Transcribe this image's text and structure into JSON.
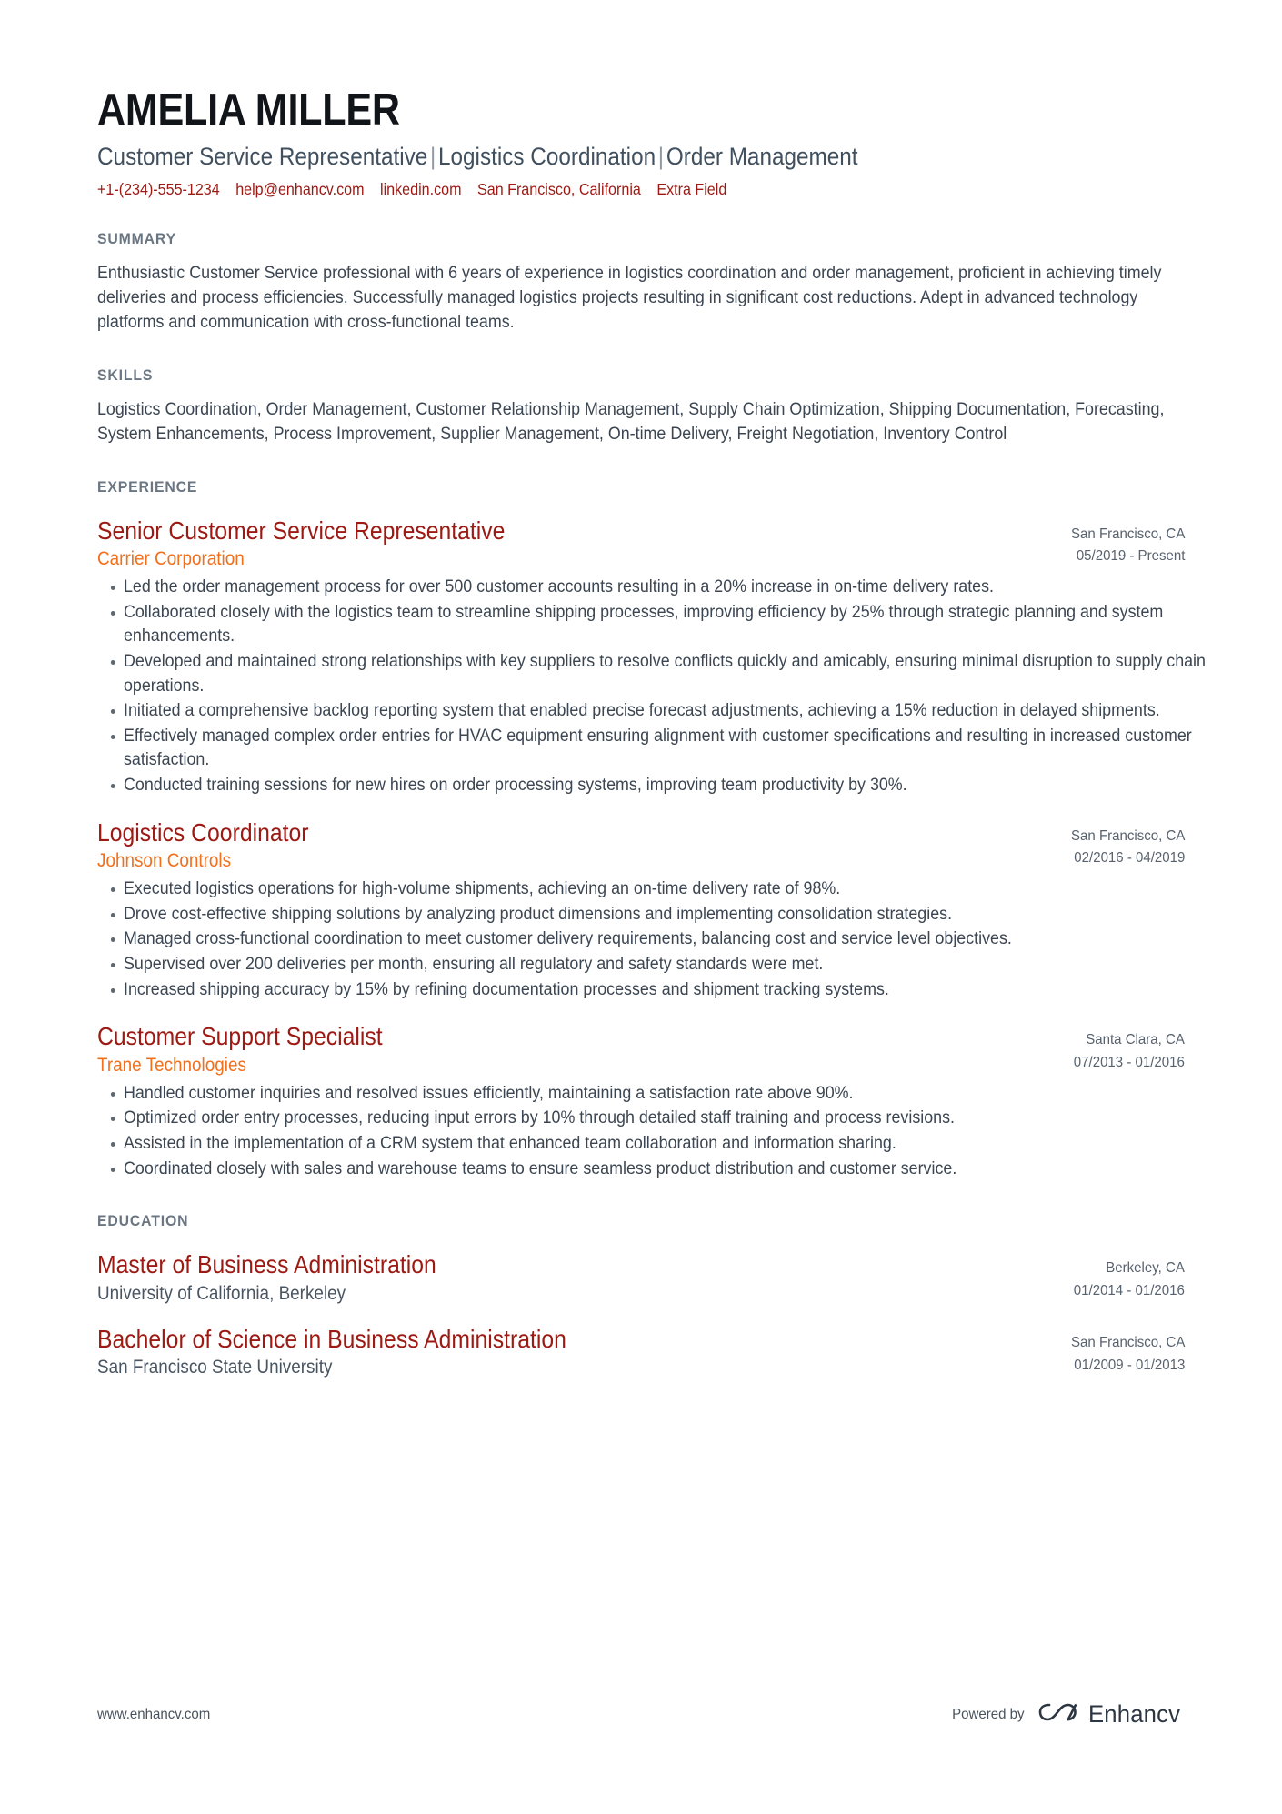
{
  "header": {
    "name": "AMELIA MILLER",
    "headline_parts": [
      "Customer Service Representative",
      "Logistics Coordination",
      "Order Management"
    ],
    "headline_separator": "|",
    "contact": [
      {
        "name": "phone",
        "value": "+1-(234)-555-1234"
      },
      {
        "name": "email",
        "value": "help@enhancv.com"
      },
      {
        "name": "linkedin",
        "value": "linkedin.com"
      },
      {
        "name": "location",
        "value": "San Francisco, California"
      },
      {
        "name": "extra",
        "value": "Extra Field"
      }
    ]
  },
  "summary": {
    "title": "SUMMARY",
    "text": "Enthusiastic Customer Service professional with 6 years of experience in logistics coordination and order management, proficient in achieving timely deliveries and process efficiencies. Successfully managed logistics projects resulting in significant cost reductions. Adept in advanced technology platforms and communication with cross-functional teams."
  },
  "skills": {
    "title": "SKILLS",
    "text": "Logistics Coordination, Order Management, Customer Relationship Management, Supply Chain Optimization, Shipping Documentation, Forecasting, System Enhancements, Process Improvement, Supplier Management, On-time Delivery, Freight Negotiation, Inventory Control"
  },
  "experience": {
    "title": "EXPERIENCE",
    "entries": [
      {
        "job_title": "Senior Customer Service Representative",
        "company": "Carrier Corporation",
        "location": "San Francisco, CA",
        "dates": "05/2019 - Present",
        "bullets": [
          "Led the order management process for over 500 customer accounts resulting in a 20% increase in on-time delivery rates.",
          "Collaborated closely with the logistics team to streamline shipping processes, improving efficiency by 25% through strategic planning and system enhancements.",
          "Developed and maintained strong relationships with key suppliers to resolve conflicts quickly and amicably, ensuring minimal disruption to supply chain operations.",
          "Initiated a comprehensive backlog reporting system that enabled precise forecast adjustments, achieving a 15% reduction in delayed shipments.",
          "Effectively managed complex order entries for HVAC equipment ensuring alignment with customer specifications and resulting in increased customer satisfaction.",
          "Conducted training sessions for new hires on order processing systems, improving team productivity by 30%."
        ]
      },
      {
        "job_title": "Logistics Coordinator",
        "company": "Johnson Controls",
        "location": "San Francisco, CA",
        "dates": "02/2016 - 04/2019",
        "bullets": [
          "Executed logistics operations for high-volume shipments, achieving an on-time delivery rate of 98%.",
          "Drove cost-effective shipping solutions by analyzing product dimensions and implementing consolidation strategies.",
          "Managed cross-functional coordination to meet customer delivery requirements, balancing cost and service level objectives.",
          "Supervised over 200 deliveries per month, ensuring all regulatory and safety standards were met.",
          "Increased shipping accuracy by 15% by refining documentation processes and shipment tracking systems."
        ]
      },
      {
        "job_title": "Customer Support Specialist",
        "company": "Trane Technologies",
        "location": "Santa Clara, CA",
        "dates": "07/2013 - 01/2016",
        "bullets": [
          "Handled customer inquiries and resolved issues efficiently, maintaining a satisfaction rate above 90%.",
          "Optimized order entry processes, reducing input errors by 10% through detailed staff training and process revisions.",
          "Assisted in the implementation of a CRM system that enhanced team collaboration and information sharing.",
          "Coordinated closely with sales and warehouse teams to ensure seamless product distribution and customer service."
        ]
      }
    ]
  },
  "education": {
    "title": "EDUCATION",
    "entries": [
      {
        "degree": "Master of Business Administration",
        "school": "University of California, Berkeley",
        "location": "Berkeley, CA",
        "dates": "01/2014 - 01/2016"
      },
      {
        "degree": "Bachelor of Science in Business Administration",
        "school": "San Francisco State University",
        "location": "San Francisco, CA",
        "dates": "01/2009 - 01/2013"
      }
    ]
  },
  "footer": {
    "url": "www.enhancv.com",
    "powered_by": "Powered by",
    "brand": "Enhancv"
  },
  "colors": {
    "accent_red": "#9c1a13",
    "accent_orange": "#f2701d",
    "section_title": "#6b7683",
    "body_text": "#3c4652"
  }
}
